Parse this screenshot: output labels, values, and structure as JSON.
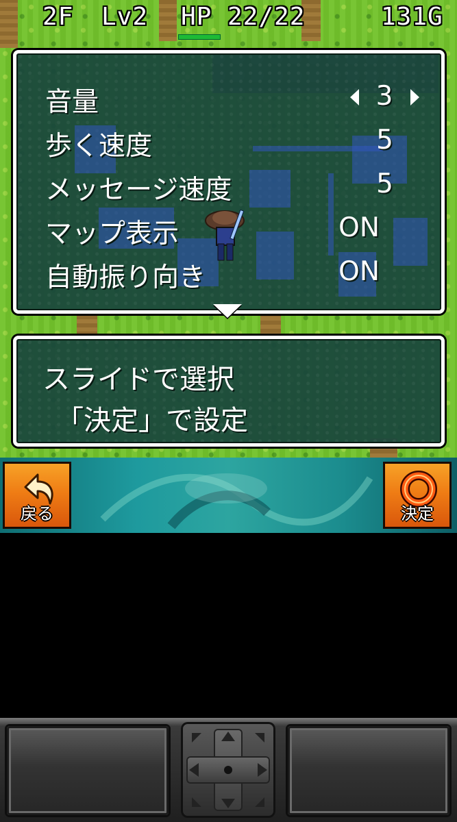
{
  "status": {
    "floor": "2F",
    "level": "Lv2",
    "hp_label": "HP",
    "hp_value": "22/22",
    "gold": "131G",
    "hp_fraction": 1.0
  },
  "settings": {
    "options": [
      {
        "label": "音量",
        "value": "3",
        "selected": true
      },
      {
        "label": "歩く速度",
        "value": "5"
      },
      {
        "label": "メッセージ速度",
        "value": "5"
      },
      {
        "label": "マップ表示",
        "value": "ON"
      },
      {
        "label": "自動振り向き",
        "value": "ON"
      }
    ]
  },
  "message": {
    "line1": "スライドで選択",
    "line2": "「決定」で設定"
  },
  "commands": {
    "back_label": "戻る",
    "ok_label": "決定"
  },
  "colors": {
    "accent": "#ef7d15",
    "hp_bar": "#1dbb35",
    "window_bg": "#19463c"
  },
  "icons": {
    "back": "back-arrow-icon",
    "ok": "circle-icon"
  }
}
